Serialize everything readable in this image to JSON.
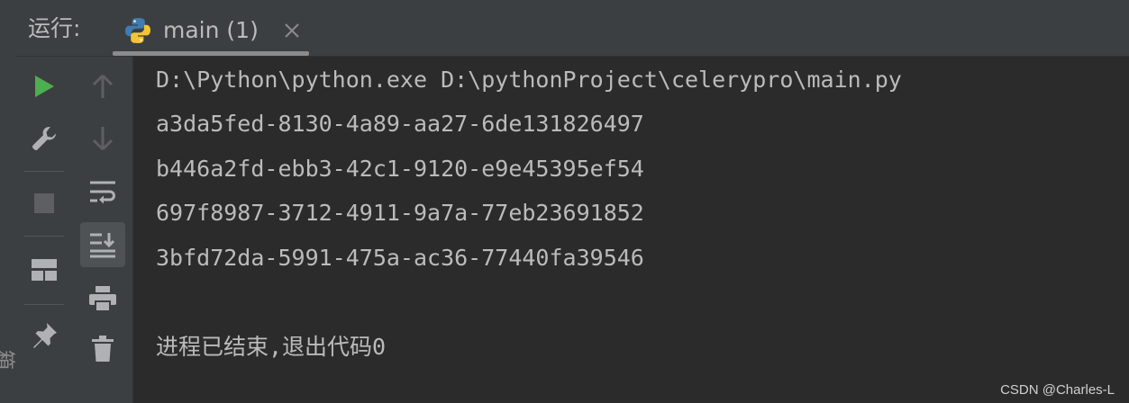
{
  "edge": {
    "glyph": "箱"
  },
  "header": {
    "run_label": "运行:",
    "tab": {
      "title": "main (1)",
      "close_symbol": "×"
    }
  },
  "console": {
    "lines": [
      "D:\\Python\\python.exe D:\\pythonProject\\celerypro\\main.py",
      "a3da5fed-8130-4a89-aa27-6de131826497",
      "b446a2fd-ebb3-42c1-9120-e9e45395ef54",
      "697f8987-3712-4911-9a7a-77eb23691852",
      "3bfd72da-5991-475a-ac36-77440fa39546",
      "进程已结束,退出代码0"
    ]
  },
  "watermark": "CSDN @Charles-L",
  "icons": {
    "col1": [
      "run-icon",
      "wrench-icon",
      "stop-icon",
      "layout-icon",
      "pin-icon"
    ],
    "col2": [
      "arrow-up-icon",
      "arrow-down-icon",
      "soft-wrap-icon",
      "scroll-to-end-icon",
      "print-icon",
      "trash-icon"
    ]
  },
  "colors": {
    "run_green": "#4caf50",
    "icon_gray": "#afb1b3",
    "text": "#bbbbbb",
    "background": "#2b2b2b",
    "panel": "#3c3f41"
  }
}
